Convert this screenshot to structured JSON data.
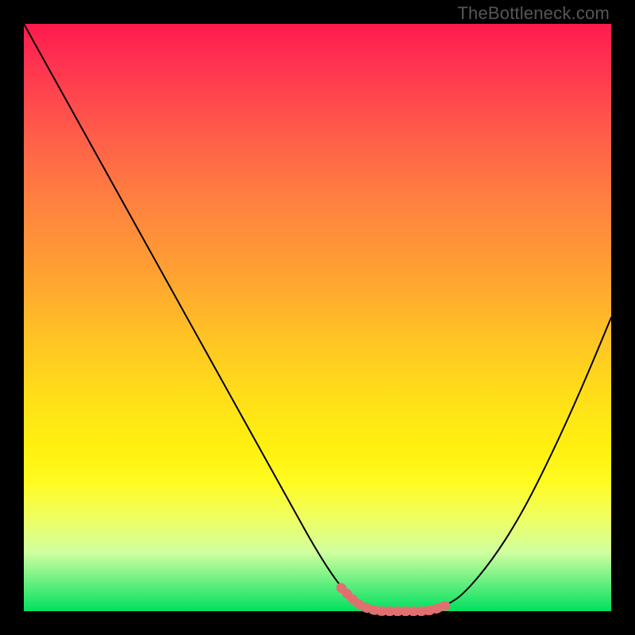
{
  "watermark": "TheBottleneck.com",
  "colors": {
    "bg": "#000000",
    "curve": "#000000",
    "accent": "#e07070",
    "gradient_top": "#ff1a4d",
    "gradient_bottom": "#00e060"
  },
  "chart_data": {
    "type": "line",
    "title": "",
    "xlabel": "",
    "ylabel": "",
    "xlim": [
      0,
      100
    ],
    "ylim": [
      0,
      100
    ],
    "series": [
      {
        "name": "curve",
        "x": [
          0,
          5,
          10,
          15,
          20,
          25,
          30,
          35,
          40,
          45,
          50,
          54,
          57,
          60,
          63,
          66,
          69,
          72,
          75,
          80,
          85,
          90,
          95,
          100
        ],
        "values": [
          100,
          91,
          82,
          73,
          64,
          55,
          46,
          37,
          28,
          19,
          10,
          4,
          1,
          0,
          0,
          0,
          0,
          1,
          3,
          9,
          17,
          27,
          38,
          50
        ]
      },
      {
        "name": "accent-band",
        "x": [
          54,
          57,
          60,
          63,
          66,
          69,
          72
        ],
        "values": [
          4,
          1,
          0,
          0,
          0,
          0,
          1
        ]
      }
    ]
  }
}
